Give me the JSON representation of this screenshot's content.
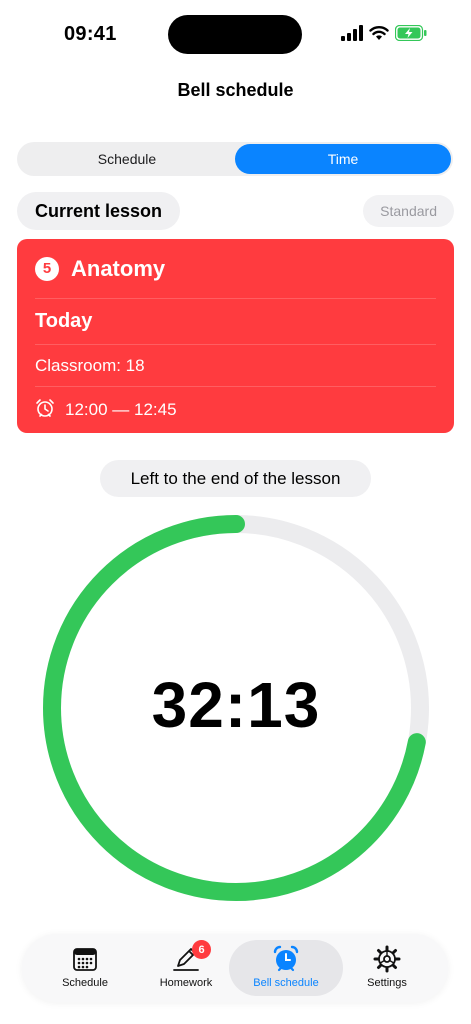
{
  "status_bar": {
    "time": "09:41",
    "icons": [
      "signal-icon",
      "wifi-icon",
      "battery-charging-icon"
    ],
    "battery_color": "#34c759"
  },
  "header": {
    "title": "Bell schedule"
  },
  "segmented": {
    "options": [
      {
        "label": "Schedule",
        "active": false
      },
      {
        "label": "Time",
        "active": true
      }
    ],
    "accent": "#0a84ff"
  },
  "lesson_header": {
    "current_label": "Current lesson",
    "schedule_type": "Standard"
  },
  "lesson": {
    "number": "5",
    "name": "Anatomy",
    "day": "Today",
    "room": "Classroom: 18",
    "time_range": "12:00 — 12:45",
    "color": "#ff3b3f"
  },
  "countdown": {
    "label": "Left to the end of the lesson",
    "value": "32:13",
    "progress_fraction": 0.72,
    "ring_color": "#34c759",
    "track_color": "#ececee"
  },
  "tab_bar": {
    "tabs": [
      {
        "label": "Schedule",
        "icon": "calendar-icon",
        "active": false
      },
      {
        "label": "Homework",
        "icon": "pencil-icon",
        "active": false,
        "badge": "6"
      },
      {
        "label": "Bell schedule",
        "icon": "alarm-clock-icon",
        "active": true
      },
      {
        "label": "Settings",
        "icon": "gear-icon",
        "active": false
      }
    ]
  }
}
